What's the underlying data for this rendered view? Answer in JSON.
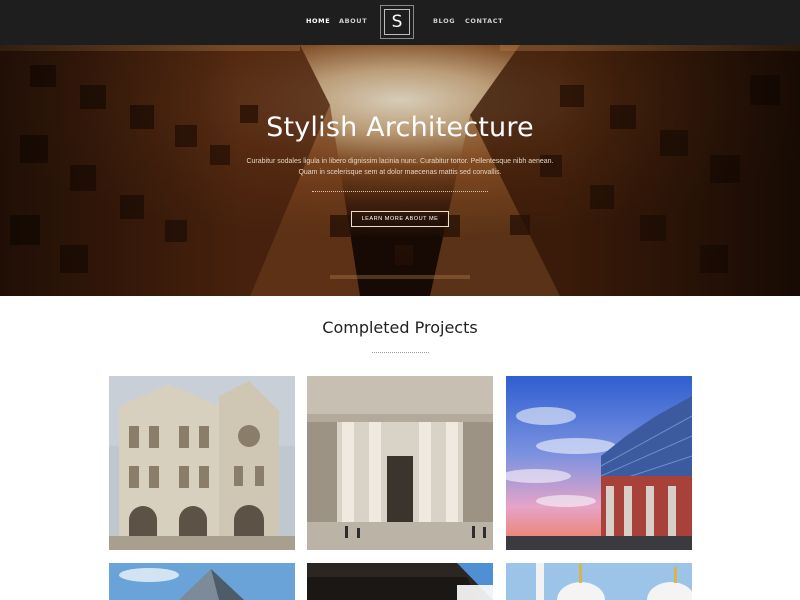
{
  "nav": {
    "left_links": [
      "HOME",
      "ABOUT"
    ],
    "right_links": [
      "BLOG",
      "CONTACT"
    ],
    "active": "HOME",
    "logo_letter": "S"
  },
  "hero": {
    "title": "Stylish Architecture",
    "text_line1": "Curabitur sodales ligula in libero dignissim lacinia nunc. Curabitur tortor. Pellentesque nibh aenean.",
    "text_line2": "Quam in scelerisque sem at dolor maecenas mattis sed convallis.",
    "button_label": "LEARN MORE ABOUT ME"
  },
  "projects": {
    "title": "Completed Projects",
    "items": [
      {
        "name": "cathedral"
      },
      {
        "name": "columned-building"
      },
      {
        "name": "glass-concert-hall"
      },
      {
        "name": "glass-pyramid"
      },
      {
        "name": "dark-facade"
      },
      {
        "name": "white-mosque"
      }
    ]
  },
  "colors": {
    "nav_bg": "#1e1e1e",
    "hero_bg": "#3a1f10",
    "accent": "#c9a27a"
  }
}
